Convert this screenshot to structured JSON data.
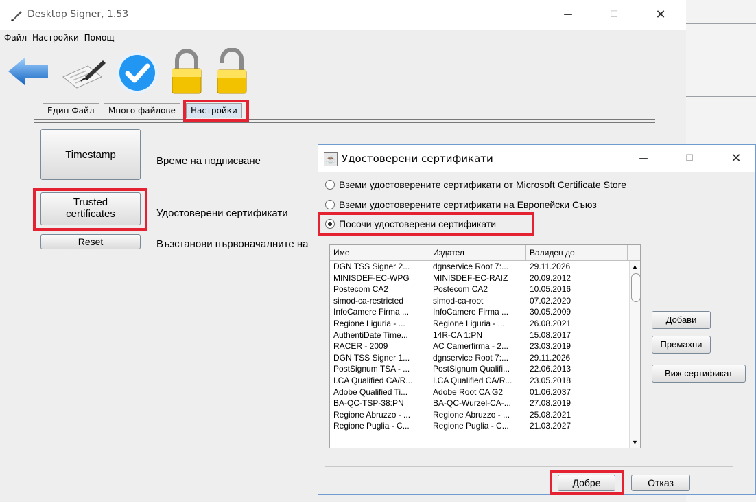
{
  "window": {
    "title": "Desktop Signer, 1.53",
    "minimize": "—",
    "maximize": "☐",
    "close": "✕"
  },
  "menu": [
    "Файл",
    "Настройки",
    "Помощ"
  ],
  "toolbar": [
    "back-arrow-icon",
    "sign-document-icon",
    "check-icon",
    "lock-closed-icon",
    "lock-open-icon"
  ],
  "tabs": [
    {
      "label": "Един Файл"
    },
    {
      "label": "Много файлове"
    },
    {
      "label": "Настройки"
    }
  ],
  "settings": {
    "timestamp_button": "Timestamp",
    "timestamp_desc": "Време на подписване",
    "trusted_button_line1": "Trusted",
    "trusted_button_line2": "certificates",
    "trusted_desc": "Удостоверени сертификати",
    "reset_button": "Reset",
    "reset_desc": "Възстанови първоначалните на"
  },
  "dialog": {
    "title": "Удостоверени сертификати",
    "minimize": "—",
    "maximize": "☐",
    "close": "✕",
    "options": [
      "Вземи удостоверените сертификати от Microsoft Certificate Store",
      "Вземи удостоверените сертификати на Европейски Съюз",
      "Посочи удостоверени сертификати"
    ],
    "columns": [
      "Име",
      "Издател",
      "Валиден до"
    ],
    "rows": [
      [
        "DGN TSS Signer 2...",
        "dgnservice Root 7:...",
        "29.11.2026"
      ],
      [
        "MINISDEF-EC-WPG",
        "MINISDEF-EC-RAIZ",
        "20.09.2012"
      ],
      [
        "Postecom CA2",
        "Postecom CA2",
        "10.05.2016"
      ],
      [
        "simod-ca-restricted",
        "simod-ca-root",
        "07.02.2020"
      ],
      [
        "InfoCamere Firma ...",
        "InfoCamere Firma ...",
        "30.05.2009"
      ],
      [
        "Regione Liguria - ...",
        "Regione Liguria - ...",
        "26.08.2021"
      ],
      [
        "AuthentiDate Time...",
        "14R-CA 1:PN",
        "15.08.2017"
      ],
      [
        "RACER - 2009",
        "AC Camerfirma - 2...",
        "23.03.2019"
      ],
      [
        "DGN TSS Signer 1...",
        "dgnservice Root 7:...",
        "29.11.2026"
      ],
      [
        "PostSignum TSA - ...",
        "PostSignum Qualifi...",
        "22.06.2013"
      ],
      [
        "I.CA Qualified CA/R...",
        "I.CA Qualified CA/R...",
        "23.05.2018"
      ],
      [
        "Adobe Qualified Ti...",
        "Adobe Root CA G2",
        "01.06.2037"
      ],
      [
        "BA-QC-TSP-38:PN",
        "BA-QC-Wurzel-CA-...",
        "27.08.2019"
      ],
      [
        "Regione Abruzzo - ...",
        "Regione Abruzzo - ...",
        "25.08.2021"
      ],
      [
        "Regione Puglia - C...",
        "Regione Puglia - C...",
        "21.03.2027"
      ]
    ],
    "buttons": {
      "add": "Добави",
      "remove": "Премахни",
      "view": "Виж сертификат",
      "ok": "Добре",
      "cancel": "Отказ"
    }
  }
}
